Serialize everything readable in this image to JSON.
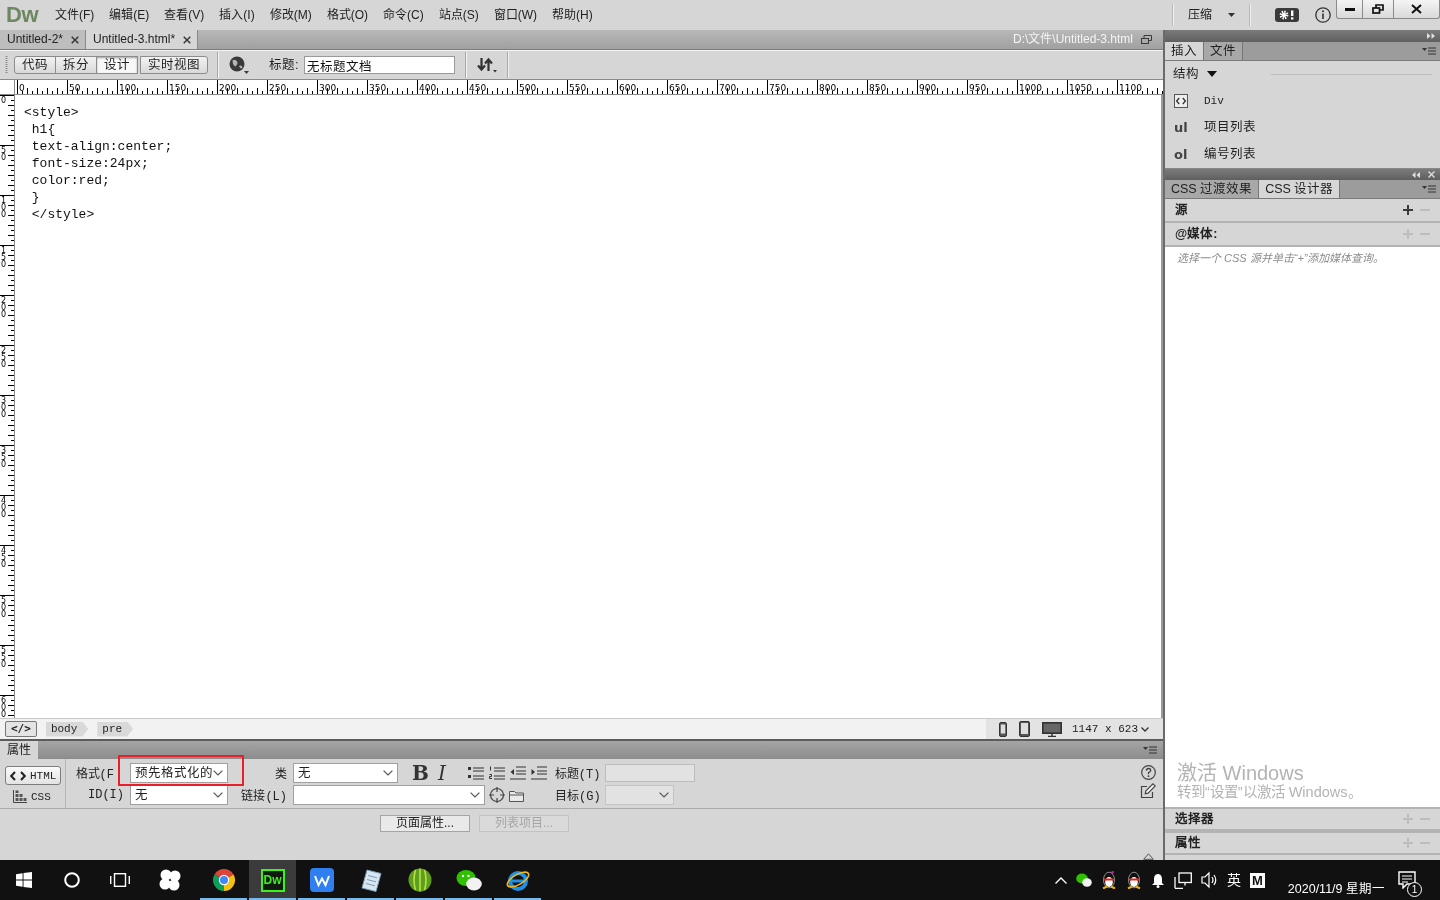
{
  "menubar": {
    "logo": "Dw",
    "items": [
      "文件(F)",
      "编辑(E)",
      "查看(V)",
      "插入(I)",
      "修改(M)",
      "格式(O)",
      "命令(C)",
      "站点(S)",
      "窗口(W)",
      "帮助(H)"
    ],
    "workspace": "压缩"
  },
  "document_tabs": [
    {
      "label": "Untitled-2*",
      "selected": false
    },
    {
      "label": "Untitled-3.html*",
      "selected": true
    }
  ],
  "document_path": "D:\\文件\\Untitled-3.html",
  "document_toolbar": {
    "views": [
      {
        "label": "代码",
        "selected": false
      },
      {
        "label": "拆分",
        "selected": false
      },
      {
        "label": "设计",
        "selected": true
      },
      {
        "label": "实时视图",
        "selected": false
      }
    ],
    "title_label": "标题:",
    "title_value": "无标题文档"
  },
  "rulers": {
    "horizontal": [
      "0",
      "50",
      "100",
      "150",
      "200",
      "250",
      "300",
      "350",
      "400",
      "450",
      "500",
      "550",
      "600",
      "650",
      "700",
      "750",
      "800",
      "850",
      "900",
      "950",
      "1000",
      "1050",
      "1100"
    ],
    "vertical": [
      "0",
      "50",
      "100",
      "150",
      "200",
      "250",
      "300",
      "350",
      "400",
      "450",
      "500",
      "550",
      "600"
    ]
  },
  "design_view": {
    "lines": [
      "<style>",
      " h1{",
      " text-align:center;",
      " font-size:24px;",
      " color:red;",
      " }",
      " </style>"
    ]
  },
  "tag_selector": {
    "toggle": "</>",
    "tags": [
      "body",
      "pre"
    ],
    "window_size": "1147 x 623"
  },
  "properties": {
    "title": "属性",
    "modes": [
      {
        "label": "HTML",
        "selected": true
      },
      {
        "label": "CSS",
        "selected": false
      }
    ],
    "format": {
      "label": "格式(F",
      "value": "预先格式化的",
      "highlighted": true
    },
    "id": {
      "label": "ID(I)",
      "value": "无"
    },
    "class": {
      "label": "类",
      "value": "无"
    },
    "link": {
      "label": "链接(L)"
    },
    "text_styles": [
      {
        "kind": "bold",
        "label": "B"
      },
      {
        "kind": "italic",
        "label": "I"
      }
    ],
    "heading_field": {
      "label": "标题(T)",
      "disabled": true
    },
    "target": {
      "label": "目标(G)",
      "disabled": true
    },
    "buttons": [
      {
        "label": "页面属性...",
        "disabled": false
      },
      {
        "label": "列表项目...",
        "disabled": true
      }
    ]
  },
  "insert_panel": {
    "tabs": [
      {
        "label": "插入",
        "selected": true
      },
      {
        "label": "文件",
        "selected": false
      }
    ],
    "category": "结构",
    "items": [
      {
        "kind": "box",
        "label": "Div"
      },
      {
        "kind": "tag",
        "tag": "ul",
        "label": "项目列表"
      },
      {
        "kind": "tag",
        "tag": "ol",
        "label": "编号列表"
      }
    ]
  },
  "css_designer": {
    "tabs": [
      {
        "label": "CSS 过渡效果",
        "selected": false
      },
      {
        "label": "CSS 设计器",
        "selected": true
      }
    ],
    "sections": [
      {
        "label": "源",
        "add_enabled": true,
        "remove_enabled": false
      },
      {
        "label": "@媒体:",
        "add_enabled": false,
        "remove_enabled": false,
        "hint": "选择一个 CSS 源并单击“+”添加媒体查询。"
      },
      {
        "label": "选择器",
        "add_enabled": false,
        "remove_enabled": false
      },
      {
        "label": "属性",
        "add_enabled": false,
        "remove_enabled": false
      }
    ]
  },
  "activation_notice": {
    "title": "激活 Windows",
    "text": "转到“设置”以激活 Windows。"
  },
  "taskbar": {
    "apps": [
      {
        "running": false,
        "active": false
      },
      {
        "running": true,
        "active": false
      },
      {
        "label": "Dw",
        "running": true,
        "active": true
      },
      {
        "running": true,
        "active": false
      },
      {
        "running": true,
        "active": false
      },
      {
        "running": true,
        "active": false
      },
      {
        "running": true,
        "active": false
      },
      {
        "running": true,
        "active": false
      }
    ],
    "input_language": "英",
    "ime_mode": "M",
    "date": "2020/11/9 星期一",
    "notification_count": "1"
  }
}
